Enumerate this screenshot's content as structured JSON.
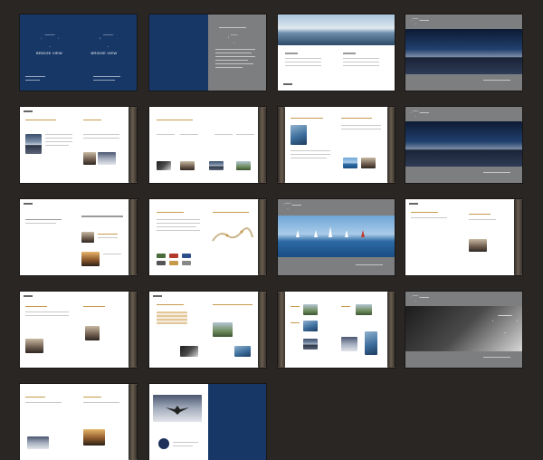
{
  "board": {
    "background_color": "#2a2624",
    "accent_colors": {
      "navy": "#173767",
      "grey": "#7d7e80",
      "gold": "#c79a4b"
    }
  },
  "cover": {
    "logo_text": "BRIDGE VIEW",
    "back_logo_text": "BRIDGE VIEW"
  }
}
